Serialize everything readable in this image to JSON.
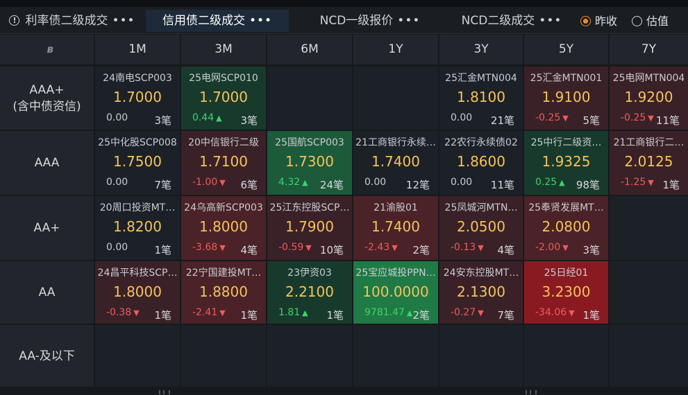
{
  "tabs": [
    {
      "label": "利率债二级成交",
      "dots": "•••",
      "active": false,
      "info": true
    },
    {
      "label": "信用债二级成交",
      "dots": "•••",
      "active": true
    },
    {
      "label": "NCD一级报价",
      "dots": "•••",
      "active": false
    },
    {
      "label": "NCD二级成交",
      "dots": "•••",
      "active": false
    }
  ],
  "radios": [
    {
      "label": "昨收",
      "checked": true
    },
    {
      "label": "估值",
      "checked": false
    }
  ],
  "columns": [
    "1M",
    "3M",
    "6M",
    "1Y",
    "3Y",
    "5Y",
    "7Y"
  ],
  "rows": [
    {
      "label": "AAA+",
      "sublabel": "(含中债资信)",
      "cells": [
        {
          "name": "24南电SCP003",
          "price": "1.7000",
          "change": "0.00",
          "dir": "flat",
          "count": "3笔",
          "tone": "neutral"
        },
        {
          "name": "25电网SCP010",
          "price": "1.7000",
          "change": "0.44",
          "dir": "up",
          "count": "3笔",
          "tone": "green1"
        },
        null,
        null,
        {
          "name": "25汇金MTN004",
          "price": "1.8100",
          "change": "0.00",
          "dir": "flat",
          "count": "21笔",
          "tone": "neutral"
        },
        {
          "name": "25汇金MTN001",
          "price": "1.9100",
          "change": "-0.25",
          "dir": "down",
          "count": "5笔",
          "tone": "red1"
        },
        {
          "name": "25电网MTN004",
          "price": "1.9200",
          "change": "-0.25",
          "dir": "down",
          "count": "11笔",
          "tone": "red1"
        }
      ]
    },
    {
      "label": "AAA",
      "sublabel": "",
      "cells": [
        {
          "name": "25中化股SCP008",
          "price": "1.7500",
          "change": "0.00",
          "dir": "flat",
          "count": "7笔",
          "tone": "neutral"
        },
        {
          "name": "20中信银行二级",
          "price": "1.7100",
          "change": "-1.00",
          "dir": "down",
          "count": "6笔",
          "tone": "red1"
        },
        {
          "name": "25国航SCP003",
          "price": "1.7300",
          "change": "4.32",
          "dir": "up",
          "count": "24笔",
          "tone": "green2"
        },
        {
          "name": "21工商银行永续…",
          "price": "1.7400",
          "change": "0.00",
          "dir": "flat",
          "count": "12笔",
          "tone": "neutral"
        },
        {
          "name": "22农行永续债02",
          "price": "1.8600",
          "change": "0.00",
          "dir": "flat",
          "count": "11笔",
          "tone": "neutral"
        },
        {
          "name": "25中行二级资…",
          "price": "1.9325",
          "change": "0.25",
          "dir": "up",
          "count": "98笔",
          "tone": "green1"
        },
        {
          "name": "21工商银行二…",
          "price": "2.0125",
          "change": "-1.25",
          "dir": "down",
          "count": "1笔",
          "tone": "red1"
        }
      ]
    },
    {
      "label": "AA+",
      "sublabel": "",
      "cells": [
        {
          "name": "20周口投资MT…",
          "price": "1.8200",
          "change": "0.00",
          "dir": "flat",
          "count": "1笔",
          "tone": "neutral"
        },
        {
          "name": "24乌高新SCP003",
          "price": "1.8000",
          "change": "-3.68",
          "dir": "down",
          "count": "4笔",
          "tone": "red2"
        },
        {
          "name": "25江东控股SCP…",
          "price": "1.7900",
          "change": "-0.59",
          "dir": "down",
          "count": "10笔",
          "tone": "red1"
        },
        {
          "name": "21渝股01",
          "price": "1.7400",
          "change": "-2.43",
          "dir": "down",
          "count": "2笔",
          "tone": "red2"
        },
        {
          "name": "25凤城河MTN…",
          "price": "2.0500",
          "change": "-0.13",
          "dir": "down",
          "count": "4笔",
          "tone": "red1"
        },
        {
          "name": "25奉贤发展MT…",
          "price": "2.0800",
          "change": "-2.00",
          "dir": "down",
          "count": "3笔",
          "tone": "red2"
        },
        null
      ]
    },
    {
      "label": "AA",
      "sublabel": "",
      "cells": [
        {
          "name": "24昌平科技SCP…",
          "price": "1.8000",
          "change": "-0.38",
          "dir": "down",
          "count": "1笔",
          "tone": "red1"
        },
        {
          "name": "22宁国建投MT…",
          "price": "1.8800",
          "change": "-2.41",
          "dir": "down",
          "count": "1笔",
          "tone": "red2"
        },
        {
          "name": "23伊资03",
          "price": "2.2100",
          "change": "1.81",
          "dir": "up",
          "count": "1笔",
          "tone": "green1"
        },
        {
          "name": "25宝应城投PPN…",
          "price": "100.0000",
          "change": "9781.47",
          "dir": "up",
          "count": "2笔",
          "tone": "green3"
        },
        {
          "name": "24安东控股MT…",
          "price": "2.1300",
          "change": "-0.27",
          "dir": "down",
          "count": "7笔",
          "tone": "red1"
        },
        {
          "name": "25日经01",
          "price": "3.2300",
          "change": "-34.06",
          "dir": "down",
          "count": "1笔",
          "tone": "red3"
        },
        null
      ]
    },
    {
      "label": "AA-及以下",
      "sublabel": "",
      "cells": [
        null,
        null,
        null,
        null,
        null,
        null,
        null
      ]
    }
  ],
  "colors": {
    "neutral": "#1c2128",
    "green1": "#173a2c",
    "green2": "#1c5a3a",
    "green3": "#1f7a45",
    "red1": "#3a2128",
    "red2": "#4a2228",
    "red3": "#8a1a22"
  }
}
